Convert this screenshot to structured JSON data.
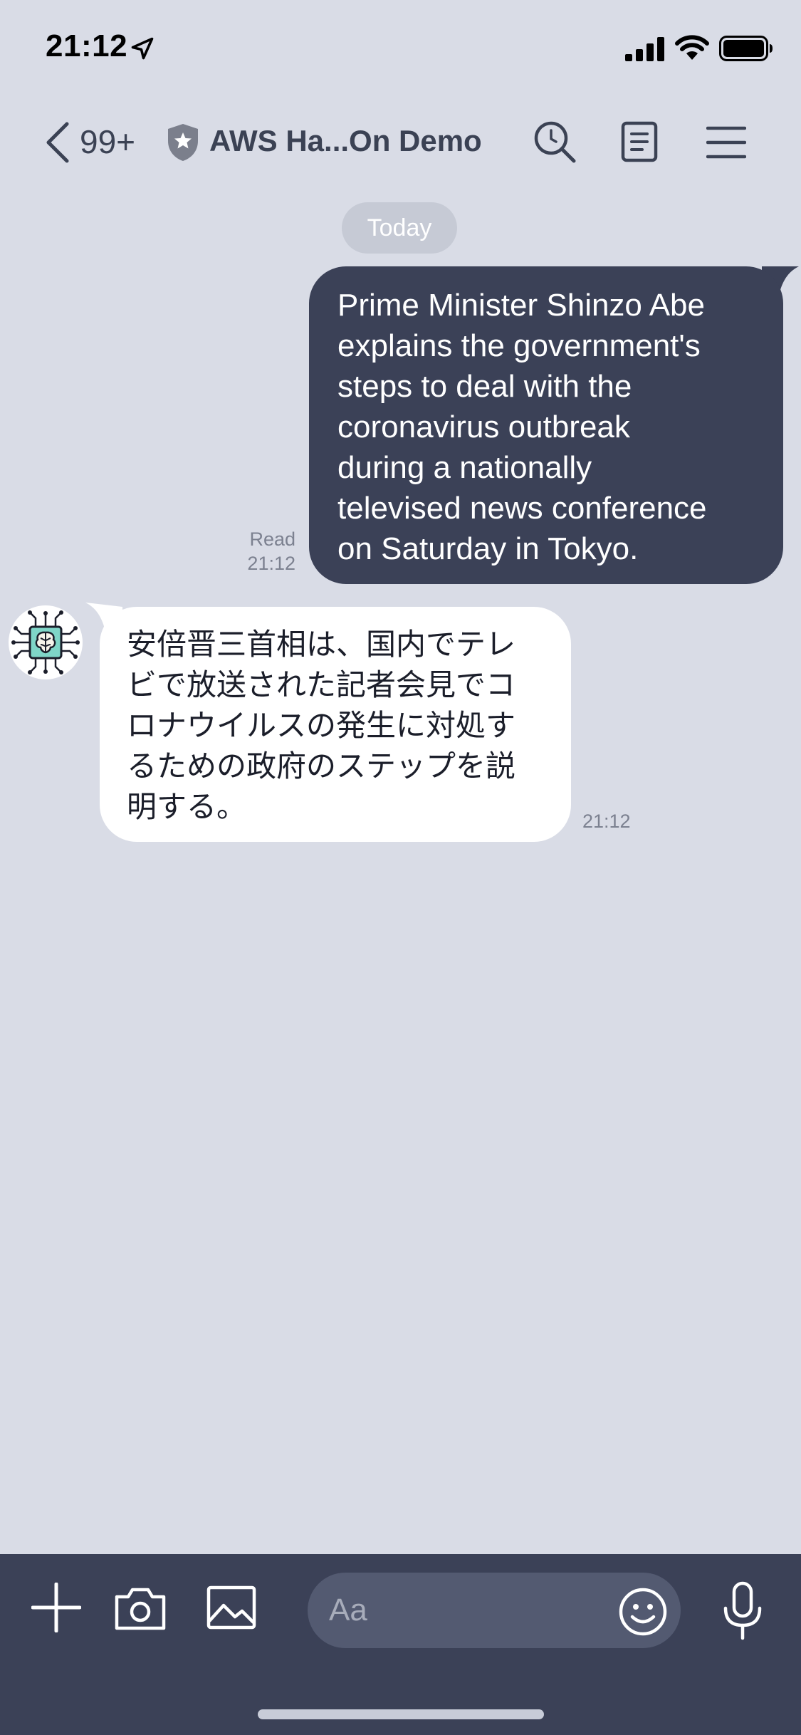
{
  "status_bar": {
    "time": "21:12"
  },
  "nav": {
    "unread_count": "99+",
    "title": "AWS Ha...On Demo"
  },
  "chat": {
    "date_label": "Today",
    "messages": [
      {
        "direction": "outgoing",
        "lines": [
          "Prime Minister Shinzo Abe",
          "explains the government's",
          "steps to deal with the",
          "coronavirus outbreak",
          "during a nationally",
          "televised news conference",
          "on Saturday in Tokyo."
        ],
        "read_label": "Read",
        "time": "21:12"
      },
      {
        "direction": "incoming",
        "lines": [
          "安倍晋三首相は、国内でテレ",
          "ビで放送された記者会見でコ",
          "ロナウイルスの発生に対処す",
          "るための政府のステップを説",
          "明する。"
        ],
        "time": "21:12"
      }
    ]
  },
  "input_bar": {
    "placeholder": "Aa"
  },
  "colors": {
    "background": "#d9dce6",
    "outgoing_bubble": "#3b4157",
    "incoming_bubble": "#ffffff",
    "input_bar": "#3b4157",
    "date_chip": "#c6cad5"
  },
  "icons": [
    "location-arrow-icon",
    "signal-icon",
    "wifi-icon",
    "battery-icon",
    "back-chevron-icon",
    "shield-star-icon",
    "search-icon",
    "notes-icon",
    "menu-icon",
    "plus-icon",
    "camera-icon",
    "image-icon",
    "emoji-icon",
    "microphone-icon"
  ]
}
